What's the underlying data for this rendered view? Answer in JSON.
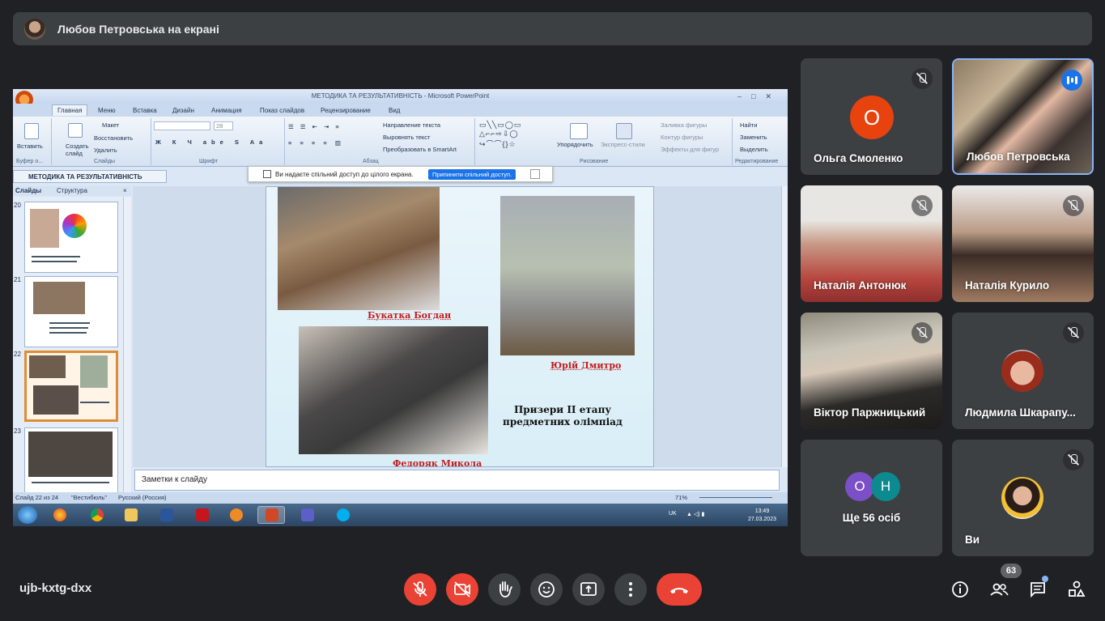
{
  "banner": {
    "presenting_text": "Любов Петровська на екрані"
  },
  "shared_screen": {
    "window_title": "МЕТОДИКА ТА РЕЗУЛЬТАТИВНІСТЬ - Microsoft PowerPoint",
    "ribbon_tabs": [
      "Главная",
      "Меню",
      "Вставка",
      "Дизайн",
      "Анимация",
      "Показ слайдов",
      "Рецензирование",
      "Вид"
    ],
    "ribbon": {
      "paste": "Вставить",
      "create_slide": "Создать слайд",
      "layout": "Макет",
      "restore": "Восстановить",
      "delete": "Удалить",
      "group_clipboard": "Буфер о...",
      "group_slides": "Слайды",
      "group_font": "Шрифт",
      "group_paragraph": "Абзац",
      "group_drawing": "Рисование",
      "group_editing": "Редактирование",
      "font_size": "28",
      "text_direction": "Направление текста",
      "align_text": "Выровнять текст",
      "smartart": "Преобразовать в SmartArt",
      "arrange": "Упорядочить",
      "quick_styles": "Экспресс-стили",
      "fill": "Заливка фигуры",
      "outline": "Контур фигуры",
      "effects": "Эффекты для фигур",
      "find": "Найти",
      "replace": "Заменить",
      "select": "Выделить"
    },
    "share_bar": {
      "message": "Ви надаєте спільний доступ до цілого екрана.",
      "stop_button": "Припинити спільний доступ."
    },
    "doc_tab": "МЕТОДИКА ТА РЕЗУЛЬТАТИВНІСТЬ",
    "pane_tabs": [
      "Слайды",
      "Структура"
    ],
    "thumb_numbers": [
      "20",
      "21",
      "22",
      "23"
    ],
    "slide": {
      "caption_1": "Букатка Богдан",
      "caption_2": "Юрій Дмитро",
      "caption_3": "Федоряк Микола",
      "title_line_1": "Призери ІІ етапу",
      "title_line_2": "предметних олімпіад"
    },
    "notes_placeholder": "Заметки к слайду",
    "status": {
      "slide_of": "Слайд 22 из 24",
      "theme": "\"Вестибюль\"",
      "language": "Русский (Россия)",
      "zoom": "71%"
    },
    "tray": {
      "lang": "UK",
      "time": "13:49",
      "date": "27.03.2023"
    }
  },
  "participants": [
    {
      "name": "Ольга Смоленко",
      "avatar_letter": "О",
      "avatar_color": "#e8430e",
      "muted": true
    },
    {
      "name": "Любов Петровська",
      "speaking": true
    },
    {
      "name": "Наталія Антонюк",
      "muted": true
    },
    {
      "name": "Наталія Курило",
      "muted": true
    },
    {
      "name": "Віктор Паржницький",
      "muted": true
    },
    {
      "name": "Людмила Шкарапу...",
      "muted": true
    },
    {
      "name": "Ще 56 осіб",
      "avatar_letters": [
        "О",
        "Н"
      ],
      "avatar_colors": [
        "#7b4fc5",
        "#0d8a8f"
      ]
    },
    {
      "name": "Ви",
      "muted": true
    }
  ],
  "bottom_bar": {
    "meeting_code": "ujb-kxtg-dxx",
    "people_count": "63",
    "colors": {
      "danger": "#ea4335",
      "control": "#3c4043"
    }
  }
}
